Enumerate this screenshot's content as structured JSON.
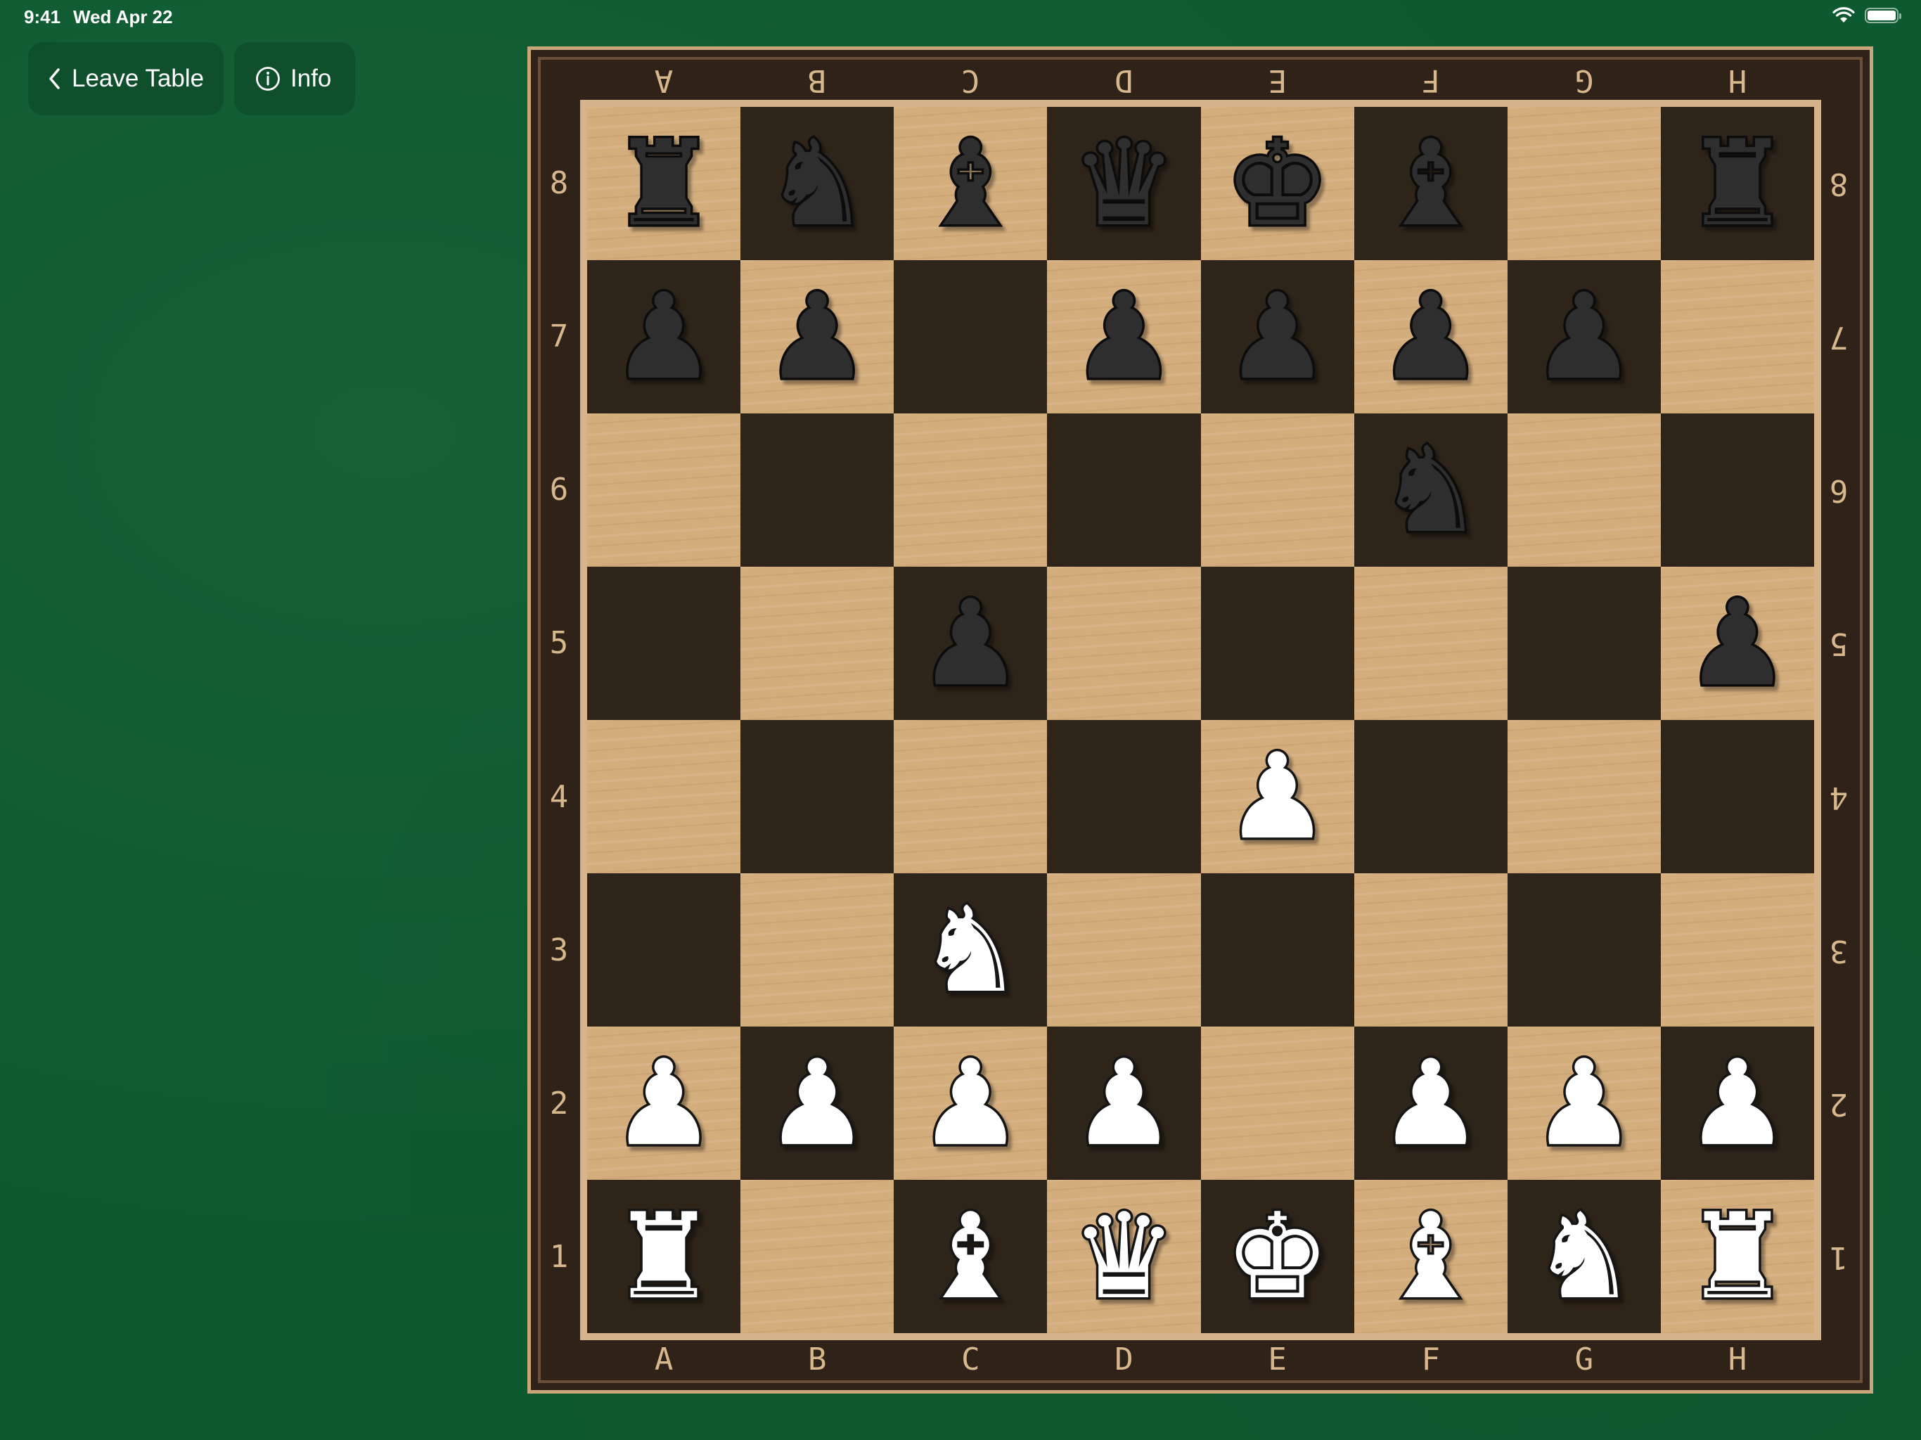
{
  "status_bar": {
    "time": "9:41",
    "date": "Wed Apr 22",
    "battery_level": 1.0,
    "icons": [
      "wifi-icon",
      "battery-icon"
    ]
  },
  "toolbar": {
    "leave_label": "Leave Table",
    "leave_icon": "chevron-left-icon",
    "info_label": "Info",
    "info_icon": "info-circle-icon"
  },
  "board": {
    "files": [
      "A",
      "B",
      "C",
      "D",
      "E",
      "F",
      "G",
      "H"
    ],
    "ranks": [
      "8",
      "7",
      "6",
      "5",
      "4",
      "3",
      "2",
      "1"
    ],
    "pieces": {
      "a8": "bR",
      "b8": "bN",
      "c8": "bB",
      "d8": "bQ",
      "e8": "bK",
      "f8": "bB",
      "h8": "bR",
      "a7": "bP",
      "b7": "bP",
      "d7": "bP",
      "e7": "bP",
      "f7": "bP",
      "g7": "bP",
      "f6": "bN",
      "c5": "bP",
      "h5": "bP",
      "e4": "wP",
      "c3": "wN",
      "a2": "wP",
      "b2": "wP",
      "c2": "wP",
      "d2": "wP",
      "f2": "wP",
      "g2": "wP",
      "h2": "wP",
      "a1": "wR",
      "c1": "wB",
      "d1": "wQ",
      "e1": "wK",
      "f1": "wB",
      "g1": "wN",
      "h1": "wR"
    }
  },
  "colors": {
    "felt": "#0d5a30",
    "light_square": "#d4ad7c",
    "dark_square": "#2f2419",
    "frame": "#2f2219",
    "coord_text": "#d8b78c"
  }
}
